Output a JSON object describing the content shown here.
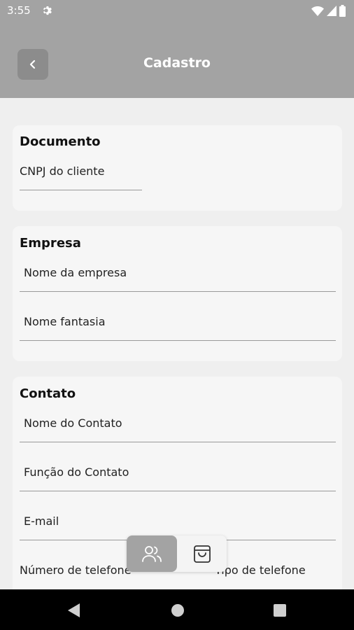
{
  "status": {
    "time": "3:55"
  },
  "header": {
    "title": "Cadastro"
  },
  "documento": {
    "title": "Documento",
    "cnpj_label": "CNPJ do cliente"
  },
  "empresa": {
    "title": "Empresa",
    "nome_label": "Nome da empresa",
    "fantasia_label": "Nome fantasia"
  },
  "contato": {
    "title": "Contato",
    "nome_label": "Nome do Contato",
    "funcao_label": "Função do Contato",
    "email_label": "E-mail",
    "telefone_label": "Número de telefone",
    "tipo_label": "Tipo de telefone"
  },
  "bottom_nav": {
    "items": [
      "users-icon",
      "shopping-bag-icon"
    ],
    "active": 0
  },
  "colors": {
    "appbar": "#a3a3a3",
    "card": "#f6f6f6",
    "background": "#efefef"
  }
}
